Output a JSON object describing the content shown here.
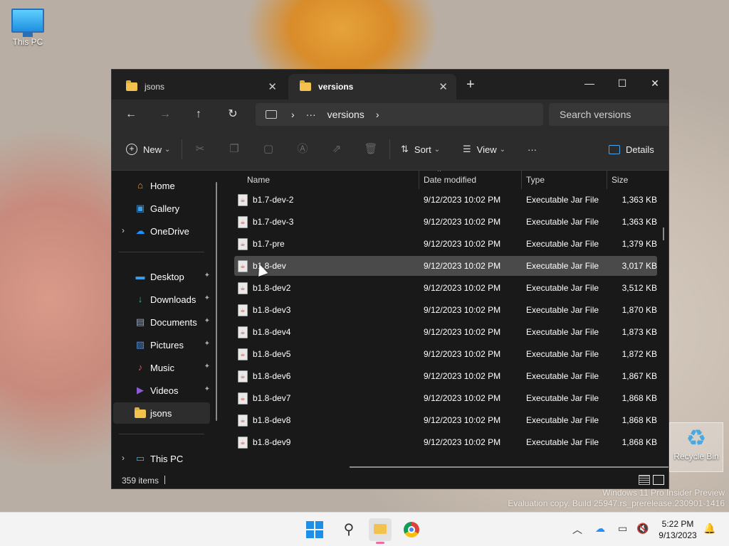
{
  "desktop": {
    "this_pc_label": "This PC",
    "recycle_bin_label": "Recycle Bin",
    "watermark_line1": "Windows 11 Pro Insider Preview",
    "watermark_line2": "Evaluation copy. Build 25947.rs_prerelease.230901-1416"
  },
  "window": {
    "tabs": [
      {
        "label": "jsons",
        "active": false
      },
      {
        "label": "versions",
        "active": true
      }
    ],
    "new_tab_icon": "plus-icon",
    "controls": {
      "minimize": "—",
      "maximize": "☐",
      "close": "✕"
    }
  },
  "navigation": {
    "back": "←",
    "forward": "→",
    "up": "↑",
    "refresh": "↻",
    "breadcrumb": {
      "chevron1": "›",
      "ellipsis": "···",
      "current": "versions",
      "chevron2": "›"
    },
    "search_placeholder": "Search versions"
  },
  "toolbar": {
    "new_label": "New",
    "sort_label": "Sort",
    "view_label": "View",
    "more_label": "···",
    "details_label": "Details",
    "dropdown_caret": "⌄"
  },
  "sidebar": {
    "top": [
      {
        "label": "Home",
        "icon": "home-icon",
        "glyph": "⌂",
        "color": "#e8a05a"
      },
      {
        "label": "Gallery",
        "icon": "gallery-icon",
        "glyph": "▣",
        "color": "#3aa0e8"
      },
      {
        "label": "OneDrive",
        "icon": "onedrive-icon",
        "glyph": "☁",
        "color": "#1e90ff",
        "expandable": true
      }
    ],
    "quick": [
      {
        "label": "Desktop",
        "icon": "desktop-icon",
        "glyph": "▬",
        "color": "#3a9ee8",
        "pinned": true
      },
      {
        "label": "Downloads",
        "icon": "downloads-icon",
        "glyph": "↓",
        "color": "#2ec27e",
        "pinned": true
      },
      {
        "label": "Documents",
        "icon": "documents-icon",
        "glyph": "▤",
        "color": "#9aa7b8",
        "pinned": true
      },
      {
        "label": "Pictures",
        "icon": "pictures-icon",
        "glyph": "▨",
        "color": "#4a90e2",
        "pinned": true
      },
      {
        "label": "Music",
        "icon": "music-icon",
        "glyph": "♪",
        "color": "#e0565a",
        "pinned": true
      },
      {
        "label": "Videos",
        "icon": "videos-icon",
        "glyph": "▶",
        "color": "#8e5ad6",
        "pinned": true
      },
      {
        "label": "jsons",
        "icon": "folder-icon",
        "glyph": "",
        "color": "#f2c14e",
        "pinned": false,
        "selected": true
      }
    ],
    "bottom": [
      {
        "label": "This PC",
        "icon": "this-pc-icon",
        "glyph": "▭",
        "color": "#3ab4f2",
        "expandable": true
      }
    ],
    "pin_glyph": "📌",
    "chevron_glyph": "›"
  },
  "columns": {
    "name": "Name",
    "date": "Date modified",
    "type": "Type",
    "size": "Size",
    "sort_indicator": "^"
  },
  "files": [
    {
      "name": "b1.7-dev-2",
      "date": "9/12/2023 10:02 PM",
      "type": "Executable Jar File",
      "size": "1,363 KB"
    },
    {
      "name": "b1.7-dev-3",
      "date": "9/12/2023 10:02 PM",
      "type": "Executable Jar File",
      "size": "1,363 KB"
    },
    {
      "name": "b1.7-pre",
      "date": "9/12/2023 10:02 PM",
      "type": "Executable Jar File",
      "size": "1,379 KB"
    },
    {
      "name": "b1.8-dev",
      "date": "9/12/2023 10:02 PM",
      "type": "Executable Jar File",
      "size": "3,017 KB",
      "selected": true
    },
    {
      "name": "b1.8-dev2",
      "date": "9/12/2023 10:02 PM",
      "type": "Executable Jar File",
      "size": "3,512 KB"
    },
    {
      "name": "b1.8-dev3",
      "date": "9/12/2023 10:02 PM",
      "type": "Executable Jar File",
      "size": "1,870 KB"
    },
    {
      "name": "b1.8-dev4",
      "date": "9/12/2023 10:02 PM",
      "type": "Executable Jar File",
      "size": "1,873 KB"
    },
    {
      "name": "b1.8-dev5",
      "date": "9/12/2023 10:02 PM",
      "type": "Executable Jar File",
      "size": "1,872 KB"
    },
    {
      "name": "b1.8-dev6",
      "date": "9/12/2023 10:02 PM",
      "type": "Executable Jar File",
      "size": "1,867 KB"
    },
    {
      "name": "b1.8-dev7",
      "date": "9/12/2023 10:02 PM",
      "type": "Executable Jar File",
      "size": "1,868 KB"
    },
    {
      "name": "b1.8-dev8",
      "date": "9/12/2023 10:02 PM",
      "type": "Executable Jar File",
      "size": "1,868 KB"
    },
    {
      "name": "b1.8-dev9",
      "date": "9/12/2023 10:02 PM",
      "type": "Executable Jar File",
      "size": "1,868 KB"
    }
  ],
  "status": {
    "item_count": "359 items"
  },
  "taskbar": {
    "time": "5:22 PM",
    "date": "9/13/2023",
    "search_glyph": "⚲",
    "tray_chevron": "︿",
    "tray_onedrive": "☁",
    "tray_network": "▭",
    "tray_volume": "🔇",
    "bell_glyph": "🔔"
  }
}
